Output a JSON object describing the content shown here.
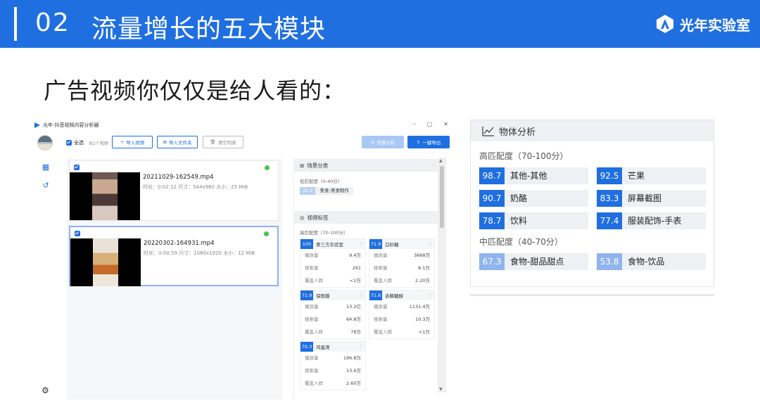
{
  "slide": {
    "number": "02",
    "title": "流量增长的五大模块",
    "brand": "光年实验室",
    "subtitle": "广告视频你仅仅是给人看的："
  },
  "app": {
    "window_title": "光年-抖音视频内容分析器",
    "controls": [
      "–",
      "▢",
      "✕"
    ],
    "toolbar": {
      "select_all": "全选",
      "video_count": "共2个视频",
      "import_video": "导入视频",
      "import_folder": "导入文件夹",
      "clear_list": "清空列表",
      "content_analysis": "内容分析",
      "export_all": "一键导出"
    },
    "videos": [
      {
        "name": "20211029-162549.mp4",
        "meta": "时长：0:02:12   尺寸：544x960   大小：25 MiB"
      },
      {
        "name": "20220302-164931.mp4",
        "meta": "时长：0:00:59   尺寸：1080x1920   大小：12 MiB"
      }
    ],
    "scene": {
      "title": "场景分类",
      "low_label": "低匹配度（0-40分）",
      "tags": [
        {
          "score": "32.2",
          "name": "美食-美食制作"
        }
      ]
    },
    "video_tags": {
      "title": "视频标签",
      "high_label": "高匹配度（70-100分）",
      "row_labels": [
        "播放量",
        "搜索量",
        "覆盖人群"
      ],
      "keywords": [
        {
          "score": "100",
          "name": "第三方实验室",
          "values": [
            "9.4万",
            "291",
            "<1万"
          ]
        },
        {
          "score": "71.9",
          "name": "白砂糖",
          "values": [
            "3668万",
            "8.1万",
            "2.20万"
          ]
        },
        {
          "score": "71.9",
          "name": "保鲜膜",
          "values": [
            "13.2亿",
            "64.8万",
            "78万"
          ]
        },
        {
          "score": "71.6",
          "name": "赤藓糖醇",
          "values": [
            "1131.4万",
            "10.3万",
            "<1万"
          ]
        },
        {
          "score": "70.3",
          "name": "鸡蛋清",
          "values": [
            "196.8万",
            "13.6万",
            "2.60万"
          ]
        }
      ]
    }
  },
  "object_analysis": {
    "title": "物体分析",
    "high_label": "高匹配度（70-100分）",
    "mid_label": "中匹配度（40-70分）",
    "high_items": [
      {
        "score": "98.7",
        "name": "其他-其他"
      },
      {
        "score": "92.5",
        "name": "芒果"
      },
      {
        "score": "90.7",
        "name": "奶酪"
      },
      {
        "score": "83.3",
        "name": "屏幕截图"
      },
      {
        "score": "78.7",
        "name": "饮料"
      },
      {
        "score": "77.4",
        "name": "服装配饰-手表"
      }
    ],
    "mid_items": [
      {
        "score": "67.3",
        "name": "食物-甜品甜点"
      },
      {
        "score": "53.8",
        "name": "食物-饮品"
      }
    ]
  },
  "colors": {
    "accent": "#1f6fe0",
    "light_accent": "#8fb4ef",
    "panel_bg": "#eef0f3"
  }
}
